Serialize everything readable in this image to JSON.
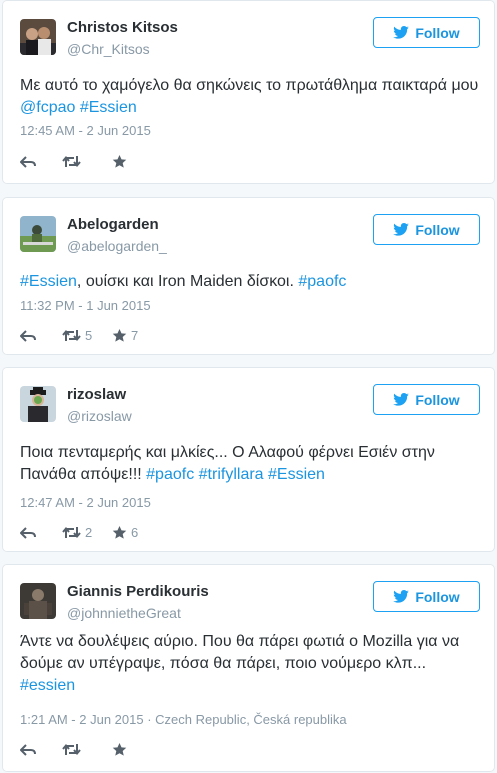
{
  "follow_label": "Follow",
  "tweets": [
    {
      "name": "Christos Kitsos",
      "handle": "@Chr_Kitsos",
      "text": "Με αυτό το χαμόγελο θα σηκώνεις το πρωτάθλημα παικταρά μου ",
      "tags": [
        "@fcpao",
        "#Essien"
      ],
      "time": "12:45 AM - 2 Jun 2015",
      "retweets": "",
      "favorites": ""
    },
    {
      "name": "Abelogarden",
      "handle": "@abelogarden_",
      "text_parts": [
        "#Essien",
        ", ουίσκι και Iron Maiden δίσκοι. ",
        "#paofc"
      ],
      "time": "11:32 PM - 1 Jun 2015",
      "retweets": "5",
      "favorites": "7"
    },
    {
      "name": "rizoslaw",
      "handle": "@rizoslaw",
      "text": "Ποια πενταμερής και μλκίες... Ο Αλαφού φέρνει Εσιέν στην Πανάθα απόψε!!! ",
      "tags": [
        "#paofc",
        "#trifyllara",
        "#Essien"
      ],
      "time": "12:47 AM - 2 Jun 2015",
      "retweets": "2",
      "favorites": "6"
    },
    {
      "name": "Giannis Perdikouris",
      "handle": "@johnniethegreat",
      "handle_display": "@johnnietheGreat",
      "text": "Άντε να δουλέψεις αύριο. Που θα πάρει φωτιά ο Mozilla για να δούμε αν υπέγραψε, πόσα θα πάρει, ποιο νούμερο κλπ... ",
      "tags": [
        "#essien"
      ],
      "time": "1:21 AM - 2 Jun 2015",
      "location": " · Czech Republic, Česká republika",
      "retweets": "",
      "favorites": ""
    }
  ]
}
